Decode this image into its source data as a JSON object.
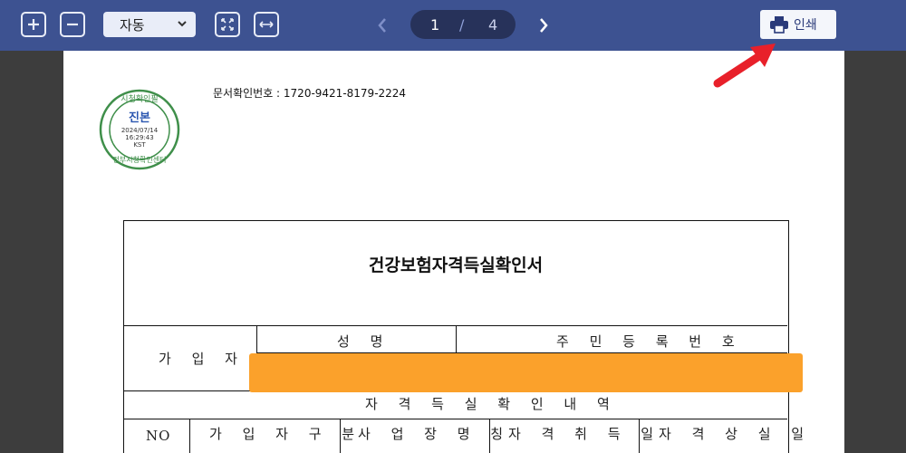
{
  "toolbar": {
    "zoom_in_icon": "plus-box-icon",
    "zoom_out_icon": "minus-box-icon",
    "zoom_select_value": "자동",
    "fit_page_icon": "fit-page-icon",
    "fit_width_icon": "fit-width-icon",
    "current_page": "1",
    "page_separator": "/",
    "total_pages": "4",
    "print_label": "인쇄",
    "colors": {
      "bar": "#3d5291",
      "pager": "#27325a"
    }
  },
  "document": {
    "doc_number": "문서확인번호 : 1720-9421-8179-2224",
    "stamp": {
      "top_text": "시청확인필",
      "center_text": "진본",
      "date": "2024/07/14",
      "time": "16:29:43",
      "tz": "KST",
      "bottom_text": "정부시청확인센터"
    },
    "title": "건강보험자격득실확인서",
    "subscriber_label": "가 입 자",
    "name_header": "성 명",
    "rrn_header": "주 민 등 록 번 호",
    "history_header": "자 격 득 실 확 인 내 역",
    "columns": [
      "NO",
      "가 입 자 구 분",
      "사 업 장 명 칭",
      "자 격 취 득 일",
      "자 격 상 실 일"
    ],
    "redaction_color": "#fba12b"
  }
}
